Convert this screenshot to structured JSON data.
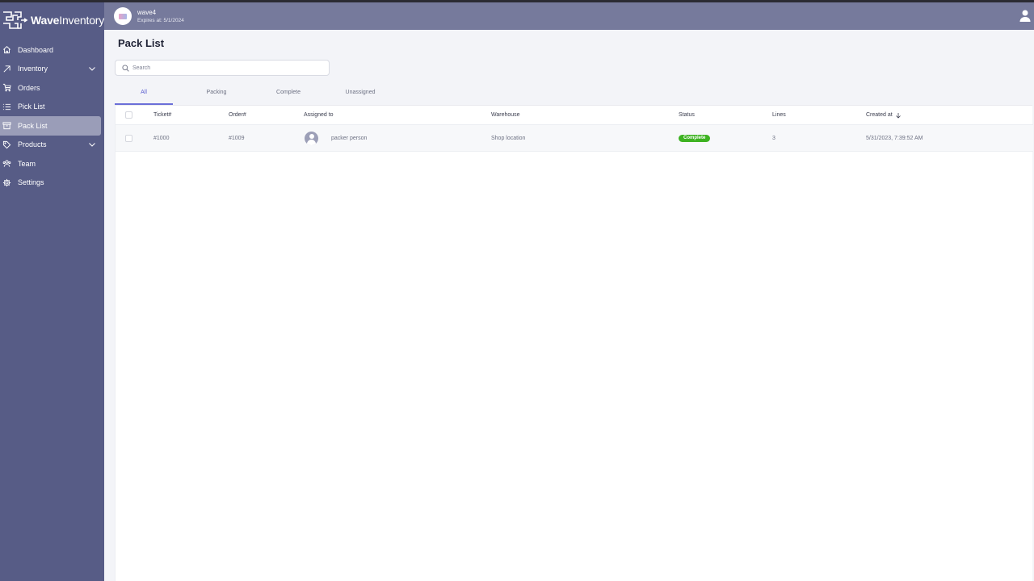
{
  "app": {
    "logo_bold": "Wave",
    "logo_light": "Inventory"
  },
  "header": {
    "org_name": "wave4",
    "org_expiry": "Expires at: 5/1/2024",
    "org_avatar_icon": "org-logo",
    "user_icon": "user-icon"
  },
  "sidebar": {
    "items": [
      {
        "label": "Dashboard",
        "icon": "home-icon",
        "has_chevron": false,
        "active": false
      },
      {
        "label": "Inventory",
        "icon": "arrow-up-right-icon",
        "has_chevron": true,
        "active": false
      },
      {
        "label": "Orders",
        "icon": "cart-icon",
        "has_chevron": false,
        "active": false
      },
      {
        "label": "Pick List",
        "icon": "list-icon",
        "has_chevron": false,
        "active": false
      },
      {
        "label": "Pack List",
        "icon": "archive-box-icon",
        "has_chevron": false,
        "active": true
      },
      {
        "label": "Products",
        "icon": "tag-icon",
        "has_chevron": true,
        "active": false
      },
      {
        "label": "Team",
        "icon": "users-icon",
        "has_chevron": false,
        "active": false
      },
      {
        "label": "Settings",
        "icon": "gear-icon",
        "has_chevron": false,
        "active": false
      }
    ]
  },
  "page": {
    "title": "Pack List",
    "search": {
      "placeholder": "Search",
      "value": ""
    },
    "tabs": [
      {
        "label": "All",
        "active": true
      },
      {
        "label": "Packing",
        "active": false
      },
      {
        "label": "Complete",
        "active": false
      },
      {
        "label": "Unassigned",
        "active": false
      }
    ]
  },
  "table": {
    "columns": [
      "Ticket#",
      "Order#",
      "Assigned to",
      "Warehouse",
      "Status",
      "Lines",
      "Created at"
    ],
    "sort_column": "Created at",
    "sort_direction": "descending",
    "rows": [
      {
        "ticket": "#1000",
        "order": "#1009",
        "assigned_to": "packer person",
        "warehouse": "Shop location",
        "status": "Complete",
        "lines": "3",
        "created_at": "5/31/2023, 7:39:52 AM"
      }
    ]
  },
  "colors": {
    "sidebar_bg": "#575c86",
    "header_bg": "#767a9c",
    "accent": "#5b5fd0",
    "status_complete": "#3db221"
  }
}
